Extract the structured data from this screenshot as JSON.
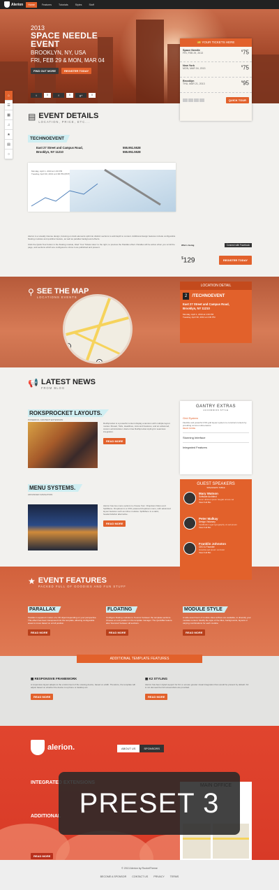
{
  "nav": {
    "brand": "Alerion",
    "items": [
      "Home",
      "Features",
      "Tutorials",
      "Styles",
      "Stuff"
    ]
  },
  "hero": {
    "year": "2013",
    "title_line1": "SPACE NEEDLE",
    "title_line2": "EVENT",
    "loc_line1": "BROOKLYN, NY, USA",
    "loc_line2": "FRI, FEB 29 & MON, MAR 04",
    "find_out_more": "FIND OUT MORE",
    "register_today": "REGISTER TODAY",
    "social": [
      {
        "icon": "twitter-icon",
        "count": "0"
      },
      {
        "icon": "facebook-icon",
        "count": "0"
      },
      {
        "icon": "gplus-icon",
        "count": "0"
      }
    ]
  },
  "tickets": {
    "heading": "YOUR TICKETS HERE",
    "rows": [
      {
        "city": "Space Needle",
        "date": "FRI, FEB 29, 2013",
        "price": "75"
      },
      {
        "city": "New York",
        "date": "MON, MAR 04, 2013",
        "price": "75"
      },
      {
        "city": "Brooklyn",
        "date": "THU, MAR 21, 2013",
        "price": "95"
      }
    ],
    "button": "QUICK TOUR"
  },
  "event_details": {
    "title": "EVENT DETAILS",
    "subtitle": "LOCATION, PRICE, ETC...",
    "venue": "TECHNOEVENT",
    "address1": "East 27 Street and Campus Road,",
    "address2": "Brooklyn, NY 11210",
    "phone1": "555.951.5528",
    "phone2": "555.951.5528",
    "date1": "Monday, April 1, 2013 at 1:00 PM",
    "date2": "Tuesday, April 30, 2013 at 4:00 PM (PDT)",
    "desc1": "Alerion is a visually intense design, focusing on dark elements split into distinct sections to add depth to content. Additional design features include configurable floating modules and quickbar feature, as well as parallax background effects.",
    "desc2": "Click the Quick Tour button in the floating module, titled 'Your Tickets Here' to the right, to preview the Parallax effect. Parallax will be active when you scroll the page, and sections which are configured to show it are published and present.",
    "whos_going": "Who's Going",
    "connect_fb": "Connect with Facebook",
    "price": "129",
    "register": "REGISTER TODAY"
  },
  "map": {
    "title": "SEE THE MAP",
    "subtitle": "LOCATIONS EVENTS",
    "detail_heading": "LOCATION DETAIL",
    "num": "2",
    "venue": "/TECHNOEVENT",
    "address1": "East 27 Street and Campus Road,",
    "address2": "Brooklyn, NY 11210",
    "date1": "Monday, April 1, 2013 at 1:00 PM",
    "date2": "Tuesday, April 30, 2013 at 4:00 PM",
    "pins": [
      "1",
      "2",
      "3"
    ]
  },
  "news": {
    "title": "LATEST NEWS",
    "subtitle": "FROM BLOG",
    "item1": {
      "title": "ROKSPROCKET LAYOUTS.",
      "sub": "POWERFUL CONTENT EXTENSION",
      "text": "RokSprocket is a powerful content display extension with multiple layout modes: Mosaic, Tabs, Headlines, Lists and Features, and an advanced, custom administrator. Alerion has RokSprocket styling for seamless integration.",
      "btn": "READ MORE"
    },
    "item2": {
      "title": "MENU SYSTEMS.",
      "sub": "ADVANCED NAVIGATION",
      "text": "Alerion has two menu options to choose from: Dropdown Menu and SplitMenu. Dropdown is a CSS powered dropdown menu, with advanced layout features such as inline modules. SplitMenu is a static, header/sidebar alternative.",
      "btn": "READ MORE"
    }
  },
  "gantry": {
    "title": "GANTRY EXTRAS",
    "sub": "ACCORDION STYLE",
    "item1": "Grid System",
    "item1_text": "Flexible and powerful CSS grid layout system to construct content by providing common dimensions",
    "more": "READ MORE",
    "item2": "Stunning Interface",
    "item3": "Integrated Features"
  },
  "guests": {
    "title": "GUEST SPEAKERS",
    "sub": "SPEAKERS TABLE",
    "list": [
      {
        "name": "Mary Watson",
        "role": "Software Architect",
        "text": "Nunc ultrices ipsum feugiat ornare vel",
        "link": "View Full Bio"
      },
      {
        "name": "Peter Malkay",
        "role": "Design Visionary",
        "text": "Vestibulum eget typography ut sed ipsum",
        "link": "View Full Bio"
      },
      {
        "name": "Franklin Johnston",
        "role": "CEO & Founder",
        "text": "Gravida sed ipsum vel dolor",
        "link": "View Full Bio"
      }
    ]
  },
  "features": {
    "title": "EVENT FEATURES",
    "subtitle": "PACKED FULL OF GOODIES AND FUN STUFF",
    "cols": [
      {
        "title": "PARALLAX",
        "text": "Parallax is apparent motion of a 3D object depending on your perspective. This effect has been transposed into the template, allowing configurable areas to move based on scroll position.",
        "btn": "READ MORE"
      },
      {
        "title": "FLOATING",
        "text": "Configure floating modules to 'bounce' between the template sections. Choose an end position in the template manager. The QuickBar feature also 'bounces' between all sections.",
        "btn": "READ MORE"
      },
      {
        "title": "MODULE STYLE",
        "text": "A wide assortment of module class suffixes are available, to diversify your modular content. Modify the style of the titles, backgrounds, layouts or varying combinations for each module.",
        "btn": "READ MORE"
      }
    ]
  },
  "additional": {
    "banner": "ADDITIONAL TEMPLATE FEATURES",
    "col1": {
      "title": "RESPONSIVE FRAMEWORK",
      "text": "A responsive layout adapts to the environment of the viewing device, based on width. Therefore, the template will adjust based on whether the device is a phone or desktop etc.",
      "btn": "READ MORE"
    },
    "col2": {
      "title": "K2 STYLING",
      "text": "Alerion has been styled support for K2, to ensure greater visual integration than would be present by default. K2 is not demoed but full screenshots are provided.",
      "btn": "READ MORE"
    }
  },
  "footer_top": {
    "brand": "alerion.",
    "tab1": "ABOUT US",
    "tab2": "SPONSORS",
    "integrated": "INTEGRATED EXTENSIONS",
    "additional": "ADDITIONAL",
    "btn": "READ MORE",
    "office": "MAIN OFFICE",
    "preset": "PRESET 3"
  },
  "footer": {
    "copyright": "© 2013 Alerion by RocketTheme",
    "links": [
      "BECOME A SPONSOR",
      "CONTACT US",
      "PRIVACY",
      "TERMS"
    ]
  }
}
